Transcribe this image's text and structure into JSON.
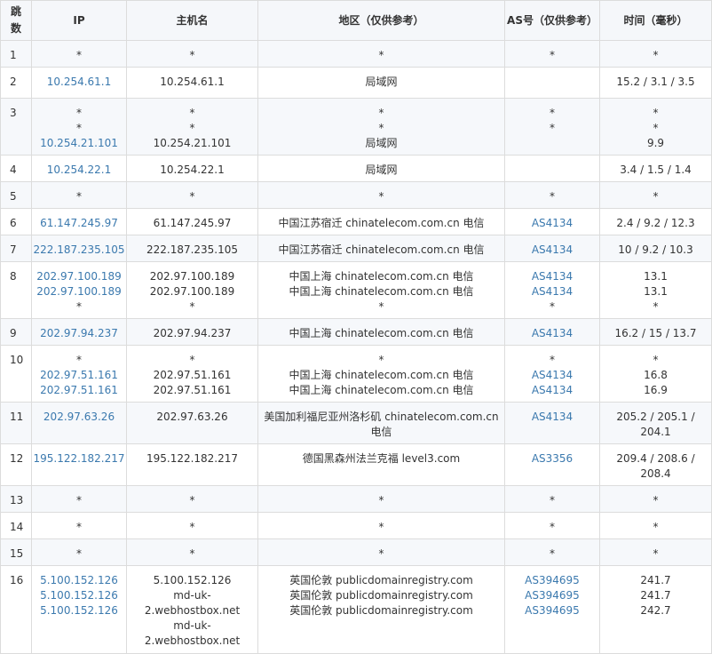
{
  "headers": {
    "hop": "跳数",
    "ip": "IP",
    "hostname": "主机名",
    "region": "地区（仅供参考）",
    "as": "AS号（仅供参考）",
    "time": "时间（毫秒）"
  },
  "rows": [
    {
      "hop": "1",
      "ip": [
        "*"
      ],
      "host": [
        "*"
      ],
      "region": [
        "*"
      ],
      "as": [
        "*"
      ],
      "time": [
        "*"
      ]
    },
    {
      "hop": "2",
      "ip": [
        "10.254.61.1"
      ],
      "host": [
        "10.254.61.1"
      ],
      "region": [
        "局域网"
      ],
      "as": [
        ""
      ],
      "time": [
        "15.2 / 3.1 / 3.5"
      ]
    },
    {
      "hop": "3",
      "ip": [
        "*",
        "*",
        "10.254.21.101"
      ],
      "host": [
        "*",
        "*",
        "10.254.21.101"
      ],
      "region": [
        "*",
        "*",
        "局域网"
      ],
      "as": [
        "*",
        "*",
        ""
      ],
      "time": [
        "*",
        "*",
        "9.9"
      ]
    },
    {
      "hop": "4",
      "ip": [
        "10.254.22.1"
      ],
      "host": [
        "10.254.22.1"
      ],
      "region": [
        "局域网"
      ],
      "as": [
        ""
      ],
      "time": [
        "3.4 / 1.5 / 1.4"
      ]
    },
    {
      "hop": "5",
      "ip": [
        "*"
      ],
      "host": [
        "*"
      ],
      "region": [
        "*"
      ],
      "as": [
        "*"
      ],
      "time": [
        "*"
      ]
    },
    {
      "hop": "6",
      "ip": [
        "61.147.245.97"
      ],
      "host": [
        "61.147.245.97"
      ],
      "region": [
        "中国江苏宿迁 chinatelecom.com.cn 电信"
      ],
      "as": [
        "AS4134"
      ],
      "time": [
        "2.4 / 9.2 / 12.3"
      ]
    },
    {
      "hop": "7",
      "ip": [
        "222.187.235.105"
      ],
      "host": [
        "222.187.235.105"
      ],
      "region": [
        "中国江苏宿迁 chinatelecom.com.cn 电信"
      ],
      "as": [
        "AS4134"
      ],
      "time": [
        "10 / 9.2 / 10.3"
      ]
    },
    {
      "hop": "8",
      "ip": [
        "202.97.100.189",
        "202.97.100.189",
        "*"
      ],
      "host": [
        "202.97.100.189",
        "202.97.100.189",
        "*"
      ],
      "region": [
        "中国上海 chinatelecom.com.cn 电信",
        "中国上海 chinatelecom.com.cn 电信",
        "*"
      ],
      "as": [
        "AS4134",
        "AS4134",
        "*"
      ],
      "time": [
        "13.1",
        "13.1",
        "*"
      ]
    },
    {
      "hop": "9",
      "ip": [
        "202.97.94.237"
      ],
      "host": [
        "202.97.94.237"
      ],
      "region": [
        "中国上海 chinatelecom.com.cn 电信"
      ],
      "as": [
        "AS4134"
      ],
      "time": [
        "16.2 / 15 / 13.7"
      ]
    },
    {
      "hop": "10",
      "ip": [
        "*",
        "202.97.51.161",
        "202.97.51.161"
      ],
      "host": [
        "*",
        "202.97.51.161",
        "202.97.51.161"
      ],
      "region": [
        "*",
        "中国上海 chinatelecom.com.cn 电信",
        "中国上海 chinatelecom.com.cn 电信"
      ],
      "as": [
        "*",
        "AS4134",
        "AS4134"
      ],
      "time": [
        "*",
        "16.8",
        "16.9"
      ]
    },
    {
      "hop": "11",
      "ip": [
        "202.97.63.26"
      ],
      "host": [
        "202.97.63.26"
      ],
      "region": [
        "美国加利福尼亚州洛杉矶 chinatelecom.com.cn",
        "电信"
      ],
      "as": [
        "AS4134"
      ],
      "time": [
        "205.2 / 205.1 /",
        "204.1"
      ]
    },
    {
      "hop": "12",
      "ip": [
        "195.122.182.217"
      ],
      "host": [
        "195.122.182.217"
      ],
      "region": [
        "德国黑森州法兰克福 level3.com"
      ],
      "as": [
        "AS3356"
      ],
      "time": [
        "209.4 / 208.6 /",
        "208.4"
      ]
    },
    {
      "hop": "13",
      "ip": [
        "*"
      ],
      "host": [
        "*"
      ],
      "region": [
        "*"
      ],
      "as": [
        "*"
      ],
      "time": [
        "*"
      ]
    },
    {
      "hop": "14",
      "ip": [
        "*"
      ],
      "host": [
        "*"
      ],
      "region": [
        "*"
      ],
      "as": [
        "*"
      ],
      "time": [
        "*"
      ]
    },
    {
      "hop": "15",
      "ip": [
        "*"
      ],
      "host": [
        "*"
      ],
      "region": [
        "*"
      ],
      "as": [
        "*"
      ],
      "time": [
        "*"
      ]
    },
    {
      "hop": "16",
      "ip": [
        "5.100.152.126",
        "5.100.152.126",
        "5.100.152.126"
      ],
      "host": [
        "5.100.152.126",
        "md-uk-",
        "2.webhostbox.net",
        "md-uk-",
        "2.webhostbox.net"
      ],
      "region": [
        "英国伦敦 publicdomainregistry.com",
        "英国伦敦 publicdomainregistry.com",
        "英国伦敦 publicdomainregistry.com"
      ],
      "as": [
        "AS394695",
        "AS394695",
        "AS394695"
      ],
      "time": [
        "241.7",
        "241.7",
        "242.7"
      ]
    }
  ],
  "colors": {
    "link": "#3b79ae",
    "text": "#333333",
    "border": "#dcdcdc",
    "stripe": "#f6f8fb"
  }
}
